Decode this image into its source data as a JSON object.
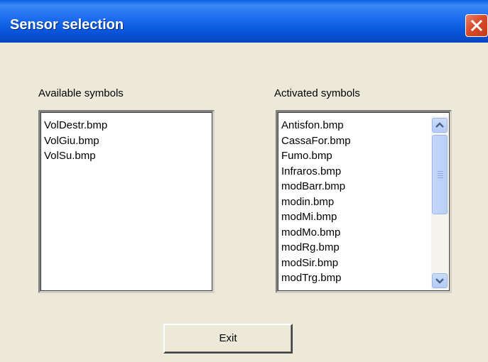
{
  "window": {
    "title": "Sensor selection"
  },
  "available": {
    "label": "Available symbols",
    "items": [
      "VolDestr.bmp",
      "VolGiu.bmp",
      "VolSu.bmp"
    ]
  },
  "activated": {
    "label": "Activated symbols",
    "items": [
      "Antisfon.bmp",
      "CassaFor.bmp",
      "Fumo.bmp",
      "Infraros.bmp",
      "modBarr.bmp",
      "modin.bmp",
      "modMi.bmp",
      "modMo.bmp",
      "modRg.bmp",
      "modSir.bmp",
      "modTrg.bmp"
    ]
  },
  "buttons": {
    "exit_label": "Exit"
  },
  "icons": {
    "close": "close-icon",
    "scroll_up": "chevron-up-icon",
    "scroll_down": "chevron-down-icon"
  }
}
